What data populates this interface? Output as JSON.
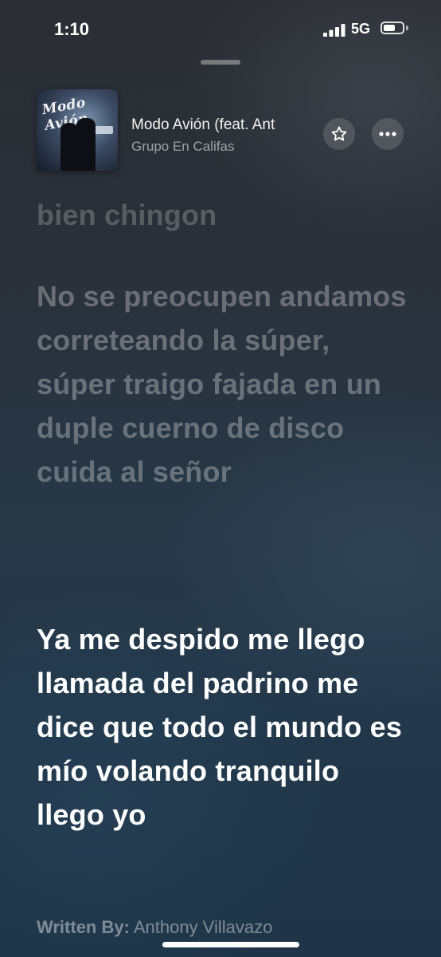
{
  "status": {
    "time": "1:10",
    "network": "5G",
    "signal_icon": "cellular-signal-icon",
    "battery_icon": "battery-icon"
  },
  "now_playing": {
    "album_art_text": "Modo Avión",
    "title": "Modo Avión (feat. Ant",
    "artist": "Grupo En Califas"
  },
  "lyrics": {
    "previous_line": "bien chingon",
    "past_line": "No se preocupen andamos correteando la súper, súper traigo fajada en un duple cuerno de disco cuida al señor",
    "current_line": "Ya me despido me llego llamada del padrino me dice que todo el mundo es mío volando tranquilo llego yo"
  },
  "credits": {
    "label": "Written By:",
    "writers": "Anthony Villavazo"
  },
  "colors": {
    "background_top": "#2b2e33",
    "background_bottom": "#1f3547",
    "active_lyric": "#ffffff"
  }
}
